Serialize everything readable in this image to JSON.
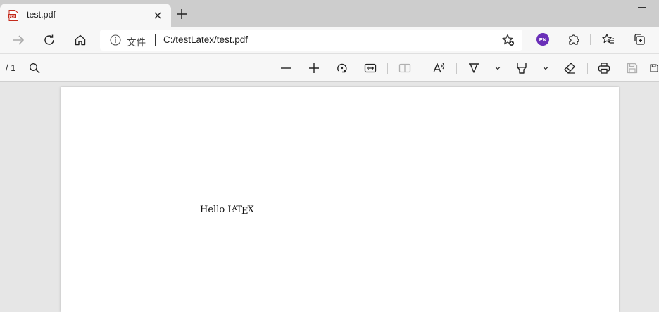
{
  "tab": {
    "title": "test.pdf",
    "icon": "pdf-file-icon"
  },
  "address": {
    "scheme_label": "文件",
    "url": "C:/testLatex/test.pdf"
  },
  "profile": {
    "initials": "EN",
    "color": "#6a2fb8"
  },
  "pdf_toolbar": {
    "page_count": "/ 1"
  },
  "document": {
    "text_prefix": "Hello",
    "latex": {
      "L": "L",
      "A": "A",
      "T": "T",
      "E": "E",
      "X": "X"
    }
  }
}
